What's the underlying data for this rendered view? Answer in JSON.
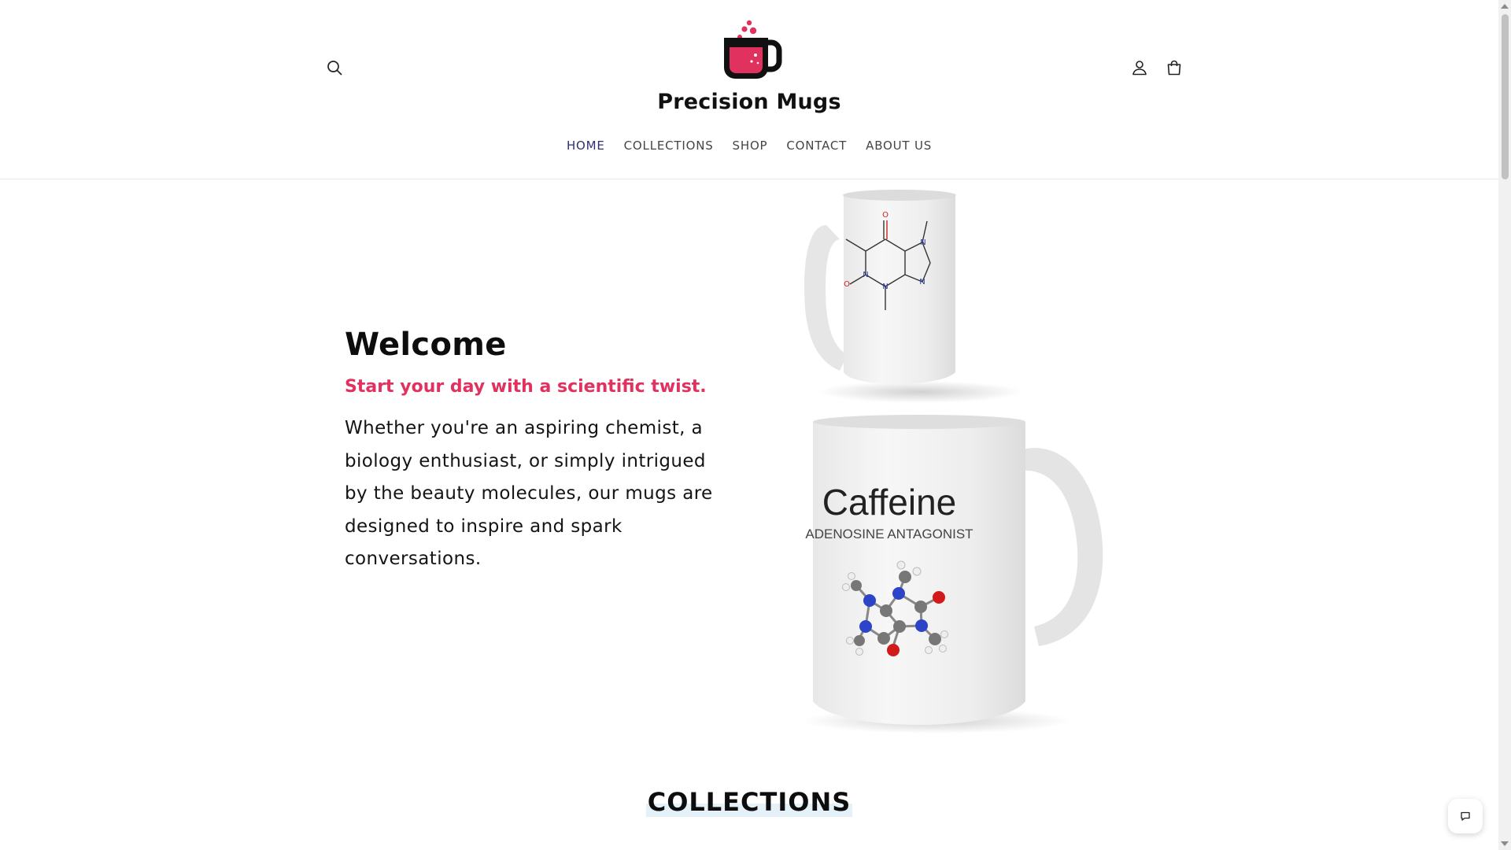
{
  "header": {
    "brand_name": "Precision Mugs",
    "icons": {
      "search": "search-icon",
      "account": "user-icon",
      "cart": "shopping-bag-icon"
    },
    "brand_colors": {
      "primary": "#e0315f",
      "dark": "#111111"
    }
  },
  "nav": {
    "items": [
      {
        "label": "HOME",
        "active": true
      },
      {
        "label": "COLLECTIONS",
        "active": false
      },
      {
        "label": "SHOP",
        "active": false
      },
      {
        "label": "CONTACT",
        "active": false
      },
      {
        "label": "ABOUT US",
        "active": false
      }
    ],
    "active_color": "#2d2f72"
  },
  "hero": {
    "title": "Welcome",
    "subtitle": "Start your day with a scientific twist.",
    "body": "Whether you're an aspiring chemist, a biology enthusiast, or simply intrigued by the beauty molecules, our mugs are designed to inspire and spark conversations.",
    "image": {
      "mug_title": "Caffeine",
      "mug_subtitle": "ADENOSINE ANTAGONIST",
      "structure_atom_labels": [
        "O",
        "N",
        "N",
        "N",
        "N",
        "O"
      ]
    }
  },
  "collections": {
    "heading": "COLLECTIONS"
  },
  "chat": {
    "icon": "chat-icon"
  }
}
